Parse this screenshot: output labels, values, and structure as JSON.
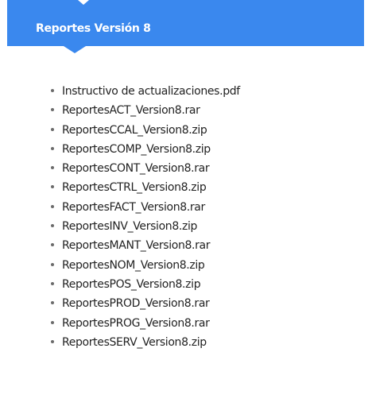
{
  "section": {
    "title": "Reportes Versión 8",
    "accent_color": "#3a88ee"
  },
  "files": [
    "Instructivo de actualizaciones.pdf",
    "ReportesACT_Version8.rar",
    "ReportesCCAL_Version8.zip",
    "ReportesCOMP_Version8.zip",
    "ReportesCONT_Version8.rar",
    "ReportesCTRL_Version8.zip",
    "ReportesFACT_Version8.rar",
    "ReportesINV_Version8.zip",
    "ReportesMANT_Version8.rar",
    "ReportesNOM_Version8.zip",
    "ReportesPOS_Version8.zip",
    "ReportesPROD_Version8.rar",
    "ReportesPROG_Version8.rar",
    "ReportesSERV_Version8.zip"
  ]
}
